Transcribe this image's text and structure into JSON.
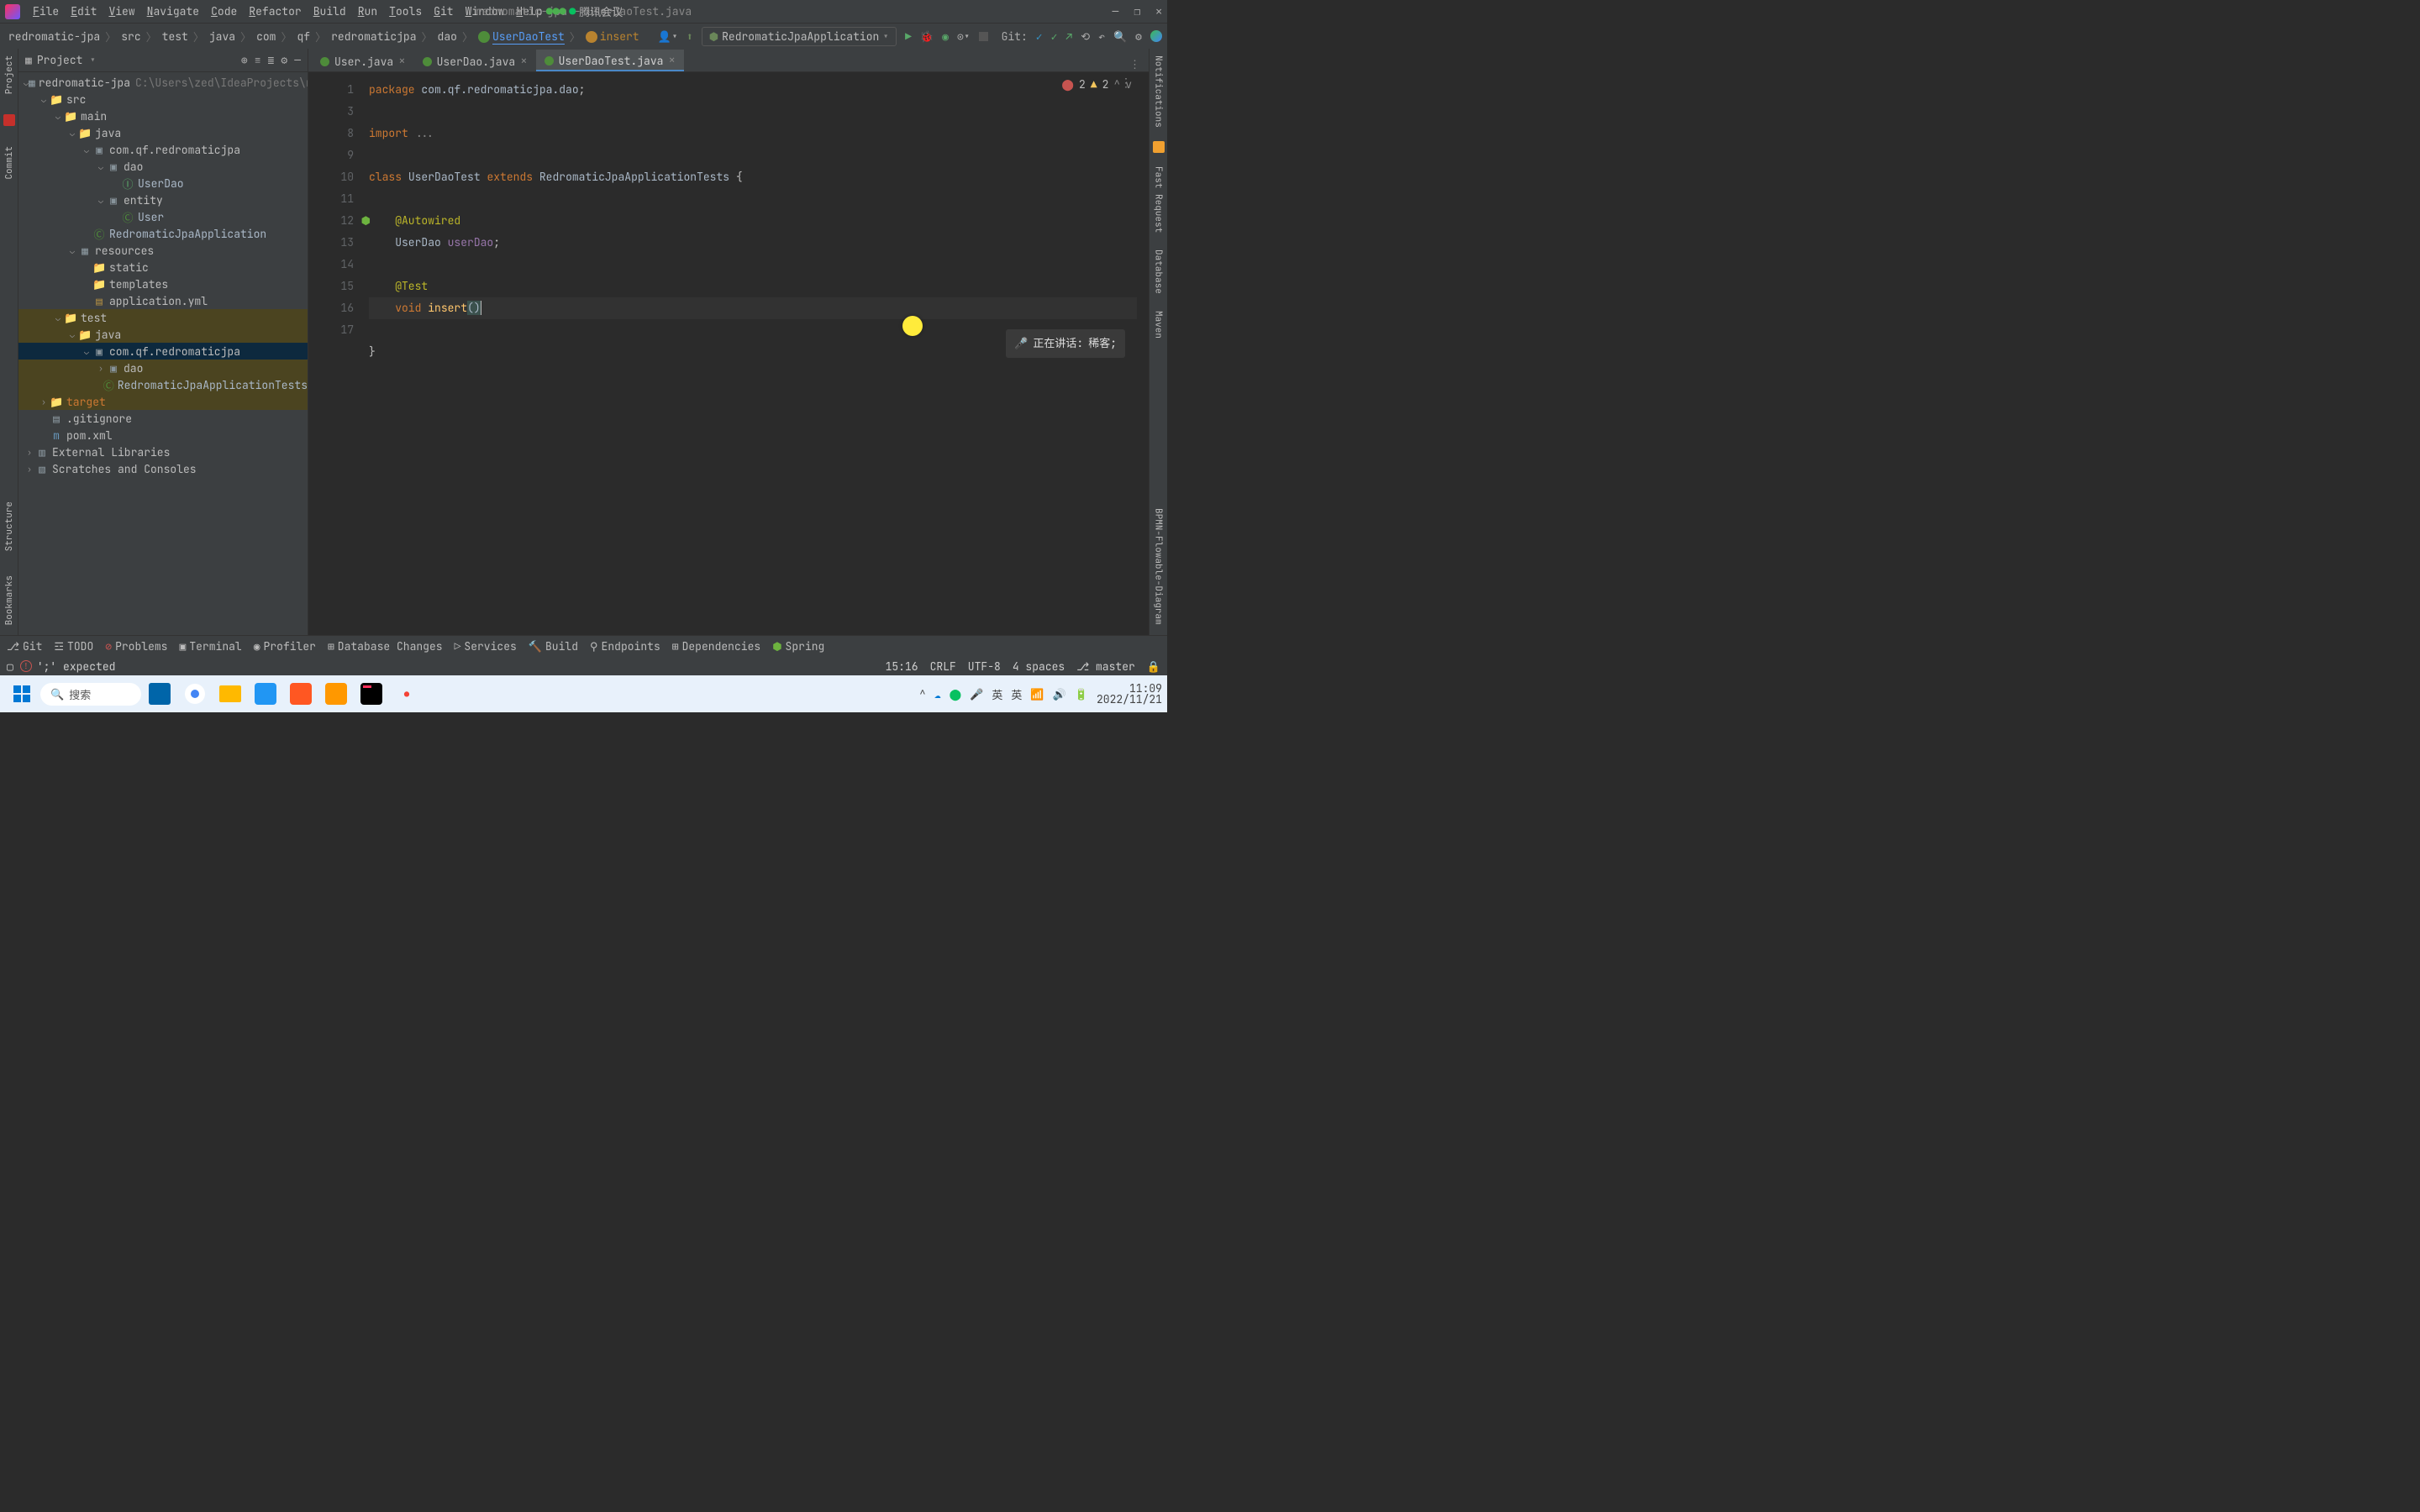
{
  "menubar": {
    "items": [
      "File",
      "Edit",
      "View",
      "Navigate",
      "Code",
      "Refactor",
      "Build",
      "Run",
      "Tools",
      "Git",
      "Window",
      "Help"
    ],
    "title": "redromatic-jpa – UserDaoTest.java",
    "meeting_app": "腾讯会议"
  },
  "toolbar": {
    "crumbs": [
      "redromatic-jpa",
      "src",
      "test",
      "java",
      "com",
      "qf",
      "redromaticjpa",
      "dao"
    ],
    "class_crumb": "UserDaoTest",
    "method_crumb": "insert",
    "runcfg": "RedromaticJpaApplication",
    "git_label": "Git:"
  },
  "sidebar": {
    "title": "Project",
    "tree": [
      {
        "ind": 0,
        "exp": "v",
        "icon": "mod",
        "label": "redromatic-jpa",
        "extra": "C:\\Users\\zed\\IdeaProjects\\redr"
      },
      {
        "ind": 1,
        "exp": "v",
        "icon": "dir",
        "label": "src"
      },
      {
        "ind": 2,
        "exp": "v",
        "icon": "dir",
        "label": "main"
      },
      {
        "ind": 3,
        "exp": "v",
        "icon": "dir",
        "label": "java"
      },
      {
        "ind": 4,
        "exp": "v",
        "icon": "pkg",
        "label": "com.qf.redromaticjpa"
      },
      {
        "ind": 5,
        "exp": "v",
        "icon": "pkg",
        "label": "dao"
      },
      {
        "ind": 6,
        "exp": "",
        "icon": "int",
        "label": "UserDao"
      },
      {
        "ind": 5,
        "exp": "v",
        "icon": "pkg",
        "label": "entity"
      },
      {
        "ind": 6,
        "exp": "",
        "icon": "cls",
        "label": "User"
      },
      {
        "ind": 4,
        "exp": "",
        "icon": "cls",
        "label": "RedromaticJpaApplication"
      },
      {
        "ind": 3,
        "exp": "v",
        "icon": "res",
        "label": "resources"
      },
      {
        "ind": 4,
        "exp": "",
        "icon": "dir",
        "label": "static"
      },
      {
        "ind": 4,
        "exp": "",
        "icon": "dir",
        "label": "templates"
      },
      {
        "ind": 4,
        "exp": "",
        "icon": "yml",
        "label": "application.yml"
      },
      {
        "ind": 2,
        "exp": "v",
        "icon": "dir",
        "label": "test",
        "hl": true
      },
      {
        "ind": 3,
        "exp": "v",
        "icon": "dir",
        "label": "java",
        "hl": true
      },
      {
        "ind": 4,
        "exp": "v",
        "icon": "pkg",
        "label": "com.qf.redromaticjpa",
        "sel": true
      },
      {
        "ind": 5,
        "exp": ">",
        "icon": "pkg",
        "label": "dao",
        "hl": true
      },
      {
        "ind": 5,
        "exp": "",
        "icon": "cls",
        "label": "RedromaticJpaApplicationTests",
        "hl": true
      },
      {
        "ind": 1,
        "exp": ">",
        "icon": "tgt",
        "label": "target",
        "hl": true
      },
      {
        "ind": 1,
        "exp": "",
        "icon": "file",
        "label": ".gitignore"
      },
      {
        "ind": 1,
        "exp": "",
        "icon": "mvn",
        "label": "pom.xml"
      },
      {
        "ind": 0,
        "exp": ">",
        "icon": "lib",
        "label": "External Libraries"
      },
      {
        "ind": 0,
        "exp": ">",
        "icon": "scr",
        "label": "Scratches and Consoles"
      }
    ]
  },
  "tabs": [
    {
      "label": "User.java",
      "active": false
    },
    {
      "label": "UserDao.java",
      "active": false
    },
    {
      "label": "UserDaoTest.java",
      "active": true
    }
  ],
  "code": {
    "lines": [
      {
        "n": "1",
        "html": "<span class='kw'>package</span> <span class='ident'>com.qf.redromaticjpa.dao</span>;"
      },
      {
        "n": "",
        "html": ""
      },
      {
        "n": "3",
        "html": "<span class='import'>import</span> <span class='comment'>...</span>"
      },
      {
        "n": "8",
        "html": ""
      },
      {
        "n": "9",
        "html": "<span class='kw'>class</span> <span class='type'>UserDaoTest</span> <span class='kw'>extends</span> <span class='type'>RedromaticJpaApplicationTests</span> {"
      },
      {
        "n": "10",
        "html": ""
      },
      {
        "n": "11",
        "html": "    <span class='ann'>@Autowired</span>"
      },
      {
        "n": "12",
        "html": "    <span class='type'>UserDao</span> <span class='field'>userDao</span>;",
        "gicon": "spring"
      },
      {
        "n": "13",
        "html": ""
      },
      {
        "n": "14",
        "html": "    <span class='ann'>@Test</span>"
      },
      {
        "n": "15",
        "html": "    <span class='kw'>void</span> <span class='method'>insert</span><span class='paren' style='background:#3b514d'>(</span><span class='paren' style='background:#3b514d'>)</span><span style='border-left:1px solid #bbb'></span>",
        "cur": true
      },
      {
        "n": "16",
        "html": ""
      },
      {
        "n": "17",
        "html": "}"
      }
    ]
  },
  "inspections": {
    "errors": "2",
    "warnings": "2"
  },
  "speaking": {
    "label": "正在讲话:",
    "who": "稀客;"
  },
  "bottombar": {
    "items": [
      "Git",
      "TODO",
      "Problems",
      "Terminal",
      "Profiler",
      "Database Changes",
      "Services",
      "Build",
      "Endpoints",
      "Dependencies",
      "Spring"
    ]
  },
  "status": {
    "error_msg": "';' expected",
    "pos": "15:16",
    "eol": "CRLF",
    "enc": "UTF-8",
    "indent": "4 spaces",
    "branch": "master"
  },
  "leftstrip": [
    "Project",
    "Redis",
    "Commit",
    "Structure",
    "Bookmarks"
  ],
  "rightstrip": [
    "Notifications",
    "Fast Request",
    "Database",
    "Maven",
    "BPMN-Flowable-Diagram"
  ],
  "taskbar": {
    "search": "搜索",
    "time": "11:09",
    "date": "2022/11/21",
    "ime": "英",
    "ime2": "英"
  }
}
